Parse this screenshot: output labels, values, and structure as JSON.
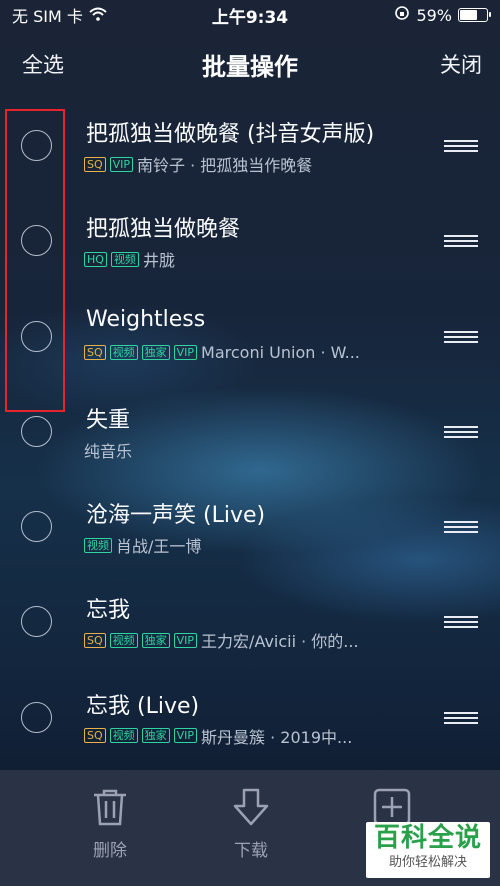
{
  "status_bar": {
    "carrier": "无 SIM 卡",
    "time": "上午9:34",
    "battery_text": "59%",
    "battery_level": 0.59
  },
  "nav": {
    "select_all": "全选",
    "title": "批量操作",
    "close": "关闭"
  },
  "songs": [
    {
      "title": "把孤独当做晚餐 (抖音女声版)",
      "tags": [
        "SQ",
        "VIP"
      ],
      "subtitle": "南铃子 · 把孤独当作晚餐"
    },
    {
      "title": "把孤独当做晚餐",
      "tags": [
        "HQ",
        "视频"
      ],
      "subtitle": "井胧"
    },
    {
      "title": "Weightless",
      "tags": [
        "SQ",
        "视频",
        "独家",
        "VIP"
      ],
      "subtitle": "Marconi Union · W..."
    },
    {
      "title": "失重",
      "tags": [],
      "subtitle": "纯音乐"
    },
    {
      "title": "沧海一声笑 (Live)",
      "tags": [
        "视频"
      ],
      "subtitle": "肖战/王一博"
    },
    {
      "title": "忘我",
      "tags": [
        "SQ",
        "视频",
        "独家",
        "VIP"
      ],
      "subtitle": "王力宏/Avicii · 你的..."
    },
    {
      "title": "忘我 (Live)",
      "tags": [
        "SQ",
        "视频",
        "独家",
        "VIP"
      ],
      "subtitle": "斯丹曼簇 · 2019中..."
    }
  ],
  "toolbar": {
    "delete_label": "删除",
    "download_label": "下载",
    "add_label": "添"
  },
  "watermark": {
    "main": "百科全说",
    "sub": "助你轻松解决"
  },
  "colors": {
    "tag_gold": "#e6b24a",
    "tag_green": "#2fd4a0",
    "highlight": "#e5242b"
  }
}
